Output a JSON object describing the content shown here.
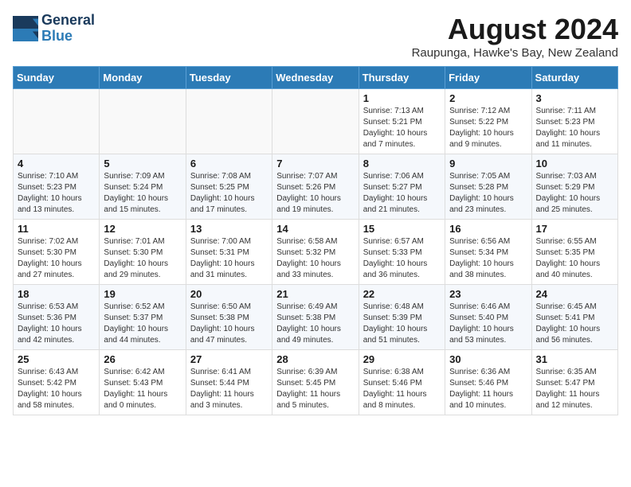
{
  "header": {
    "logo_line1": "General",
    "logo_line2": "Blue",
    "month_title": "August 2024",
    "location": "Raupunga, Hawke's Bay, New Zealand"
  },
  "days_of_week": [
    "Sunday",
    "Monday",
    "Tuesday",
    "Wednesday",
    "Thursday",
    "Friday",
    "Saturday"
  ],
  "weeks": [
    [
      {
        "day": "",
        "info": ""
      },
      {
        "day": "",
        "info": ""
      },
      {
        "day": "",
        "info": ""
      },
      {
        "day": "",
        "info": ""
      },
      {
        "day": "1",
        "info": "Sunrise: 7:13 AM\nSunset: 5:21 PM\nDaylight: 10 hours\nand 7 minutes."
      },
      {
        "day": "2",
        "info": "Sunrise: 7:12 AM\nSunset: 5:22 PM\nDaylight: 10 hours\nand 9 minutes."
      },
      {
        "day": "3",
        "info": "Sunrise: 7:11 AM\nSunset: 5:23 PM\nDaylight: 10 hours\nand 11 minutes."
      }
    ],
    [
      {
        "day": "4",
        "info": "Sunrise: 7:10 AM\nSunset: 5:23 PM\nDaylight: 10 hours\nand 13 minutes."
      },
      {
        "day": "5",
        "info": "Sunrise: 7:09 AM\nSunset: 5:24 PM\nDaylight: 10 hours\nand 15 minutes."
      },
      {
        "day": "6",
        "info": "Sunrise: 7:08 AM\nSunset: 5:25 PM\nDaylight: 10 hours\nand 17 minutes."
      },
      {
        "day": "7",
        "info": "Sunrise: 7:07 AM\nSunset: 5:26 PM\nDaylight: 10 hours\nand 19 minutes."
      },
      {
        "day": "8",
        "info": "Sunrise: 7:06 AM\nSunset: 5:27 PM\nDaylight: 10 hours\nand 21 minutes."
      },
      {
        "day": "9",
        "info": "Sunrise: 7:05 AM\nSunset: 5:28 PM\nDaylight: 10 hours\nand 23 minutes."
      },
      {
        "day": "10",
        "info": "Sunrise: 7:03 AM\nSunset: 5:29 PM\nDaylight: 10 hours\nand 25 minutes."
      }
    ],
    [
      {
        "day": "11",
        "info": "Sunrise: 7:02 AM\nSunset: 5:30 PM\nDaylight: 10 hours\nand 27 minutes."
      },
      {
        "day": "12",
        "info": "Sunrise: 7:01 AM\nSunset: 5:30 PM\nDaylight: 10 hours\nand 29 minutes."
      },
      {
        "day": "13",
        "info": "Sunrise: 7:00 AM\nSunset: 5:31 PM\nDaylight: 10 hours\nand 31 minutes."
      },
      {
        "day": "14",
        "info": "Sunrise: 6:58 AM\nSunset: 5:32 PM\nDaylight: 10 hours\nand 33 minutes."
      },
      {
        "day": "15",
        "info": "Sunrise: 6:57 AM\nSunset: 5:33 PM\nDaylight: 10 hours\nand 36 minutes."
      },
      {
        "day": "16",
        "info": "Sunrise: 6:56 AM\nSunset: 5:34 PM\nDaylight: 10 hours\nand 38 minutes."
      },
      {
        "day": "17",
        "info": "Sunrise: 6:55 AM\nSunset: 5:35 PM\nDaylight: 10 hours\nand 40 minutes."
      }
    ],
    [
      {
        "day": "18",
        "info": "Sunrise: 6:53 AM\nSunset: 5:36 PM\nDaylight: 10 hours\nand 42 minutes."
      },
      {
        "day": "19",
        "info": "Sunrise: 6:52 AM\nSunset: 5:37 PM\nDaylight: 10 hours\nand 44 minutes."
      },
      {
        "day": "20",
        "info": "Sunrise: 6:50 AM\nSunset: 5:38 PM\nDaylight: 10 hours\nand 47 minutes."
      },
      {
        "day": "21",
        "info": "Sunrise: 6:49 AM\nSunset: 5:38 PM\nDaylight: 10 hours\nand 49 minutes."
      },
      {
        "day": "22",
        "info": "Sunrise: 6:48 AM\nSunset: 5:39 PM\nDaylight: 10 hours\nand 51 minutes."
      },
      {
        "day": "23",
        "info": "Sunrise: 6:46 AM\nSunset: 5:40 PM\nDaylight: 10 hours\nand 53 minutes."
      },
      {
        "day": "24",
        "info": "Sunrise: 6:45 AM\nSunset: 5:41 PM\nDaylight: 10 hours\nand 56 minutes."
      }
    ],
    [
      {
        "day": "25",
        "info": "Sunrise: 6:43 AM\nSunset: 5:42 PM\nDaylight: 10 hours\nand 58 minutes."
      },
      {
        "day": "26",
        "info": "Sunrise: 6:42 AM\nSunset: 5:43 PM\nDaylight: 11 hours\nand 0 minutes."
      },
      {
        "day": "27",
        "info": "Sunrise: 6:41 AM\nSunset: 5:44 PM\nDaylight: 11 hours\nand 3 minutes."
      },
      {
        "day": "28",
        "info": "Sunrise: 6:39 AM\nSunset: 5:45 PM\nDaylight: 11 hours\nand 5 minutes."
      },
      {
        "day": "29",
        "info": "Sunrise: 6:38 AM\nSunset: 5:46 PM\nDaylight: 11 hours\nand 8 minutes."
      },
      {
        "day": "30",
        "info": "Sunrise: 6:36 AM\nSunset: 5:46 PM\nDaylight: 11 hours\nand 10 minutes."
      },
      {
        "day": "31",
        "info": "Sunrise: 6:35 AM\nSunset: 5:47 PM\nDaylight: 11 hours\nand 12 minutes."
      }
    ]
  ]
}
